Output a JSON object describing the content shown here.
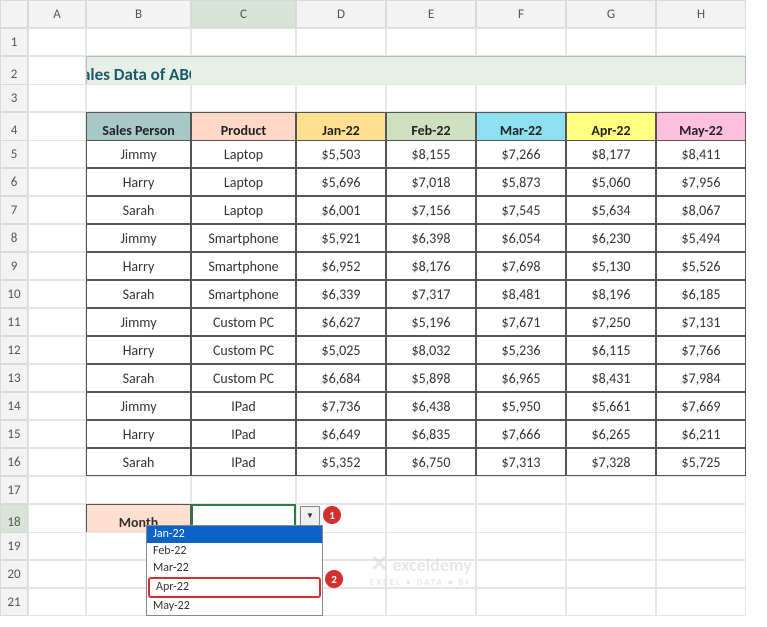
{
  "columns": [
    "A",
    "B",
    "C",
    "D",
    "E",
    "F",
    "G",
    "H"
  ],
  "activeCol": "C",
  "rows": [
    "1",
    "2",
    "3",
    "4",
    "5",
    "6",
    "7",
    "8",
    "9",
    "10",
    "11",
    "12",
    "13",
    "14",
    "15",
    "16",
    "17",
    "18",
    "19",
    "20",
    "21"
  ],
  "activeRow": "18",
  "title": "Monthly Sales Data of ABC Company",
  "headers": {
    "salesPerson": "Sales Person",
    "product": "Product",
    "jan": "Jan-22",
    "feb": "Feb-22",
    "mar": "Mar-22",
    "apr": "Apr-22",
    "may": "May-22"
  },
  "data": [
    {
      "p": "Jimmy",
      "pr": "Laptop",
      "v": [
        "$5,503",
        "$8,155",
        "$7,266",
        "$8,177",
        "$8,411"
      ]
    },
    {
      "p": "Harry",
      "pr": "Laptop",
      "v": [
        "$5,696",
        "$7,018",
        "$5,873",
        "$5,060",
        "$7,956"
      ]
    },
    {
      "p": "Sarah",
      "pr": "Laptop",
      "v": [
        "$6,001",
        "$7,156",
        "$7,545",
        "$5,634",
        "$8,067"
      ]
    },
    {
      "p": "Jimmy",
      "pr": "Smartphone",
      "v": [
        "$5,921",
        "$6,398",
        "$6,054",
        "$6,230",
        "$5,494"
      ]
    },
    {
      "p": "Harry",
      "pr": "Smartphone",
      "v": [
        "$6,952",
        "$8,176",
        "$7,698",
        "$5,130",
        "$5,526"
      ]
    },
    {
      "p": "Sarah",
      "pr": "Smartphone",
      "v": [
        "$6,339",
        "$7,317",
        "$8,481",
        "$8,196",
        "$6,185"
      ]
    },
    {
      "p": "Jimmy",
      "pr": "Custom PC",
      "v": [
        "$6,627",
        "$5,196",
        "$7,671",
        "$7,250",
        "$7,131"
      ]
    },
    {
      "p": "Harry",
      "pr": "Custom PC",
      "v": [
        "$5,025",
        "$8,032",
        "$5,236",
        "$6,115",
        "$7,766"
      ]
    },
    {
      "p": "Sarah",
      "pr": "Custom PC",
      "v": [
        "$6,684",
        "$5,898",
        "$6,965",
        "$8,431",
        "$7,984"
      ]
    },
    {
      "p": "Jimmy",
      "pr": "IPad",
      "v": [
        "$7,736",
        "$6,438",
        "$5,950",
        "$5,661",
        "$7,669"
      ]
    },
    {
      "p": "Harry",
      "pr": "IPad",
      "v": [
        "$6,649",
        "$6,835",
        "$7,666",
        "$6,265",
        "$6,211"
      ]
    },
    {
      "p": "Sarah",
      "pr": "IPad",
      "v": [
        "$5,352",
        "$6,750",
        "$7,313",
        "$7,328",
        "$5,725"
      ]
    }
  ],
  "monthLabel": "Month",
  "dropdown": {
    "items": [
      "Jan-22",
      "Feb-22",
      "Mar-22",
      "Apr-22",
      "May-22"
    ],
    "selected": "Jan-22",
    "highlighted": "Apr-22"
  },
  "badges": {
    "b1": "1",
    "b2": "2"
  },
  "watermark": {
    "brand": "exceldemy",
    "tag": "EXCEL • DATA • BI"
  },
  "chart_data": {
    "type": "table",
    "title": "Monthly Sales Data of ABC Company",
    "columns": [
      "Sales Person",
      "Product",
      "Jan-22",
      "Feb-22",
      "Mar-22",
      "Apr-22",
      "May-22"
    ],
    "rows": [
      [
        "Jimmy",
        "Laptop",
        5503,
        8155,
        7266,
        8177,
        8411
      ],
      [
        "Harry",
        "Laptop",
        5696,
        7018,
        5873,
        5060,
        7956
      ],
      [
        "Sarah",
        "Laptop",
        6001,
        7156,
        7545,
        5634,
        8067
      ],
      [
        "Jimmy",
        "Smartphone",
        5921,
        6398,
        6054,
        6230,
        5494
      ],
      [
        "Harry",
        "Smartphone",
        6952,
        8176,
        7698,
        5130,
        5526
      ],
      [
        "Sarah",
        "Smartphone",
        6339,
        7317,
        8481,
        8196,
        6185
      ],
      [
        "Jimmy",
        "Custom PC",
        6627,
        5196,
        7671,
        7250,
        7131
      ],
      [
        "Harry",
        "Custom PC",
        5025,
        8032,
        5236,
        6115,
        7766
      ],
      [
        "Sarah",
        "Custom PC",
        6684,
        5898,
        6965,
        8431,
        7984
      ],
      [
        "Jimmy",
        "IPad",
        7736,
        6438,
        5950,
        5661,
        7669
      ],
      [
        "Harry",
        "IPad",
        6649,
        6835,
        7666,
        6265,
        6211
      ],
      [
        "Sarah",
        "IPad",
        5352,
        6750,
        7313,
        7328,
        5725
      ]
    ]
  }
}
